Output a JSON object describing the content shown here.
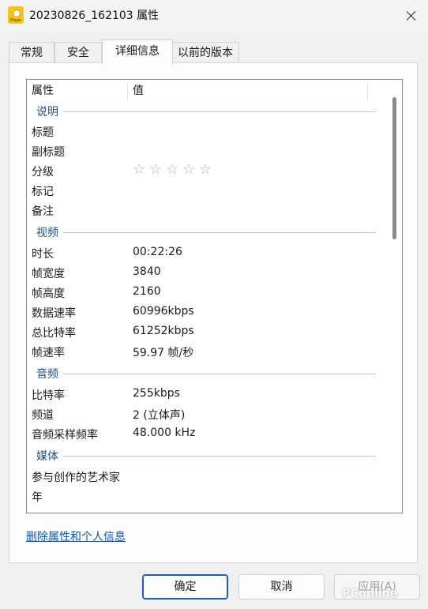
{
  "window": {
    "title": "20230826_162103 属性",
    "app_icon_text": "Player"
  },
  "tabs": [
    {
      "label": "常规"
    },
    {
      "label": "安全"
    },
    {
      "label": "详细信息"
    },
    {
      "label": "以前的版本"
    }
  ],
  "list": {
    "columns": [
      "属性",
      "值"
    ],
    "groups": {
      "description": "说明",
      "video": "视频",
      "audio": "音频",
      "media": "媒体"
    },
    "description_rows": [
      {
        "label": "标题",
        "value": ""
      },
      {
        "label": "副标题",
        "value": ""
      },
      {
        "label": "分级",
        "value": ""
      },
      {
        "label": "标记",
        "value": ""
      },
      {
        "label": "备注",
        "value": ""
      }
    ],
    "rating_stars": "☆ ☆ ☆ ☆ ☆",
    "rating_value": 0,
    "video_rows": [
      {
        "label": "时长",
        "value": "00:22:26"
      },
      {
        "label": "帧宽度",
        "value": "3840"
      },
      {
        "label": "帧高度",
        "value": "2160"
      },
      {
        "label": "数据速率",
        "value": "60996kbps"
      },
      {
        "label": "总比特率",
        "value": "61252kbps"
      },
      {
        "label": "帧速率",
        "value": "59.97 帧/秒"
      }
    ],
    "audio_rows": [
      {
        "label": "比特率",
        "value": "255kbps"
      },
      {
        "label": "频道",
        "value": "2 (立体声)"
      },
      {
        "label": "音频采样频率",
        "value": "48.000 kHz"
      }
    ],
    "media_rows": [
      {
        "label": "参与创作的艺术家",
        "value": ""
      },
      {
        "label": "年",
        "value": ""
      }
    ]
  },
  "remove_link": "删除属性和个人信息",
  "buttons": {
    "ok": "确定",
    "cancel": "取消",
    "apply": "应用(A)"
  },
  "watermark": "PConline",
  "colors": {
    "group_header": "#1f4e8c",
    "link": "#0a57b5",
    "primary_border": "#1e5fb0"
  }
}
